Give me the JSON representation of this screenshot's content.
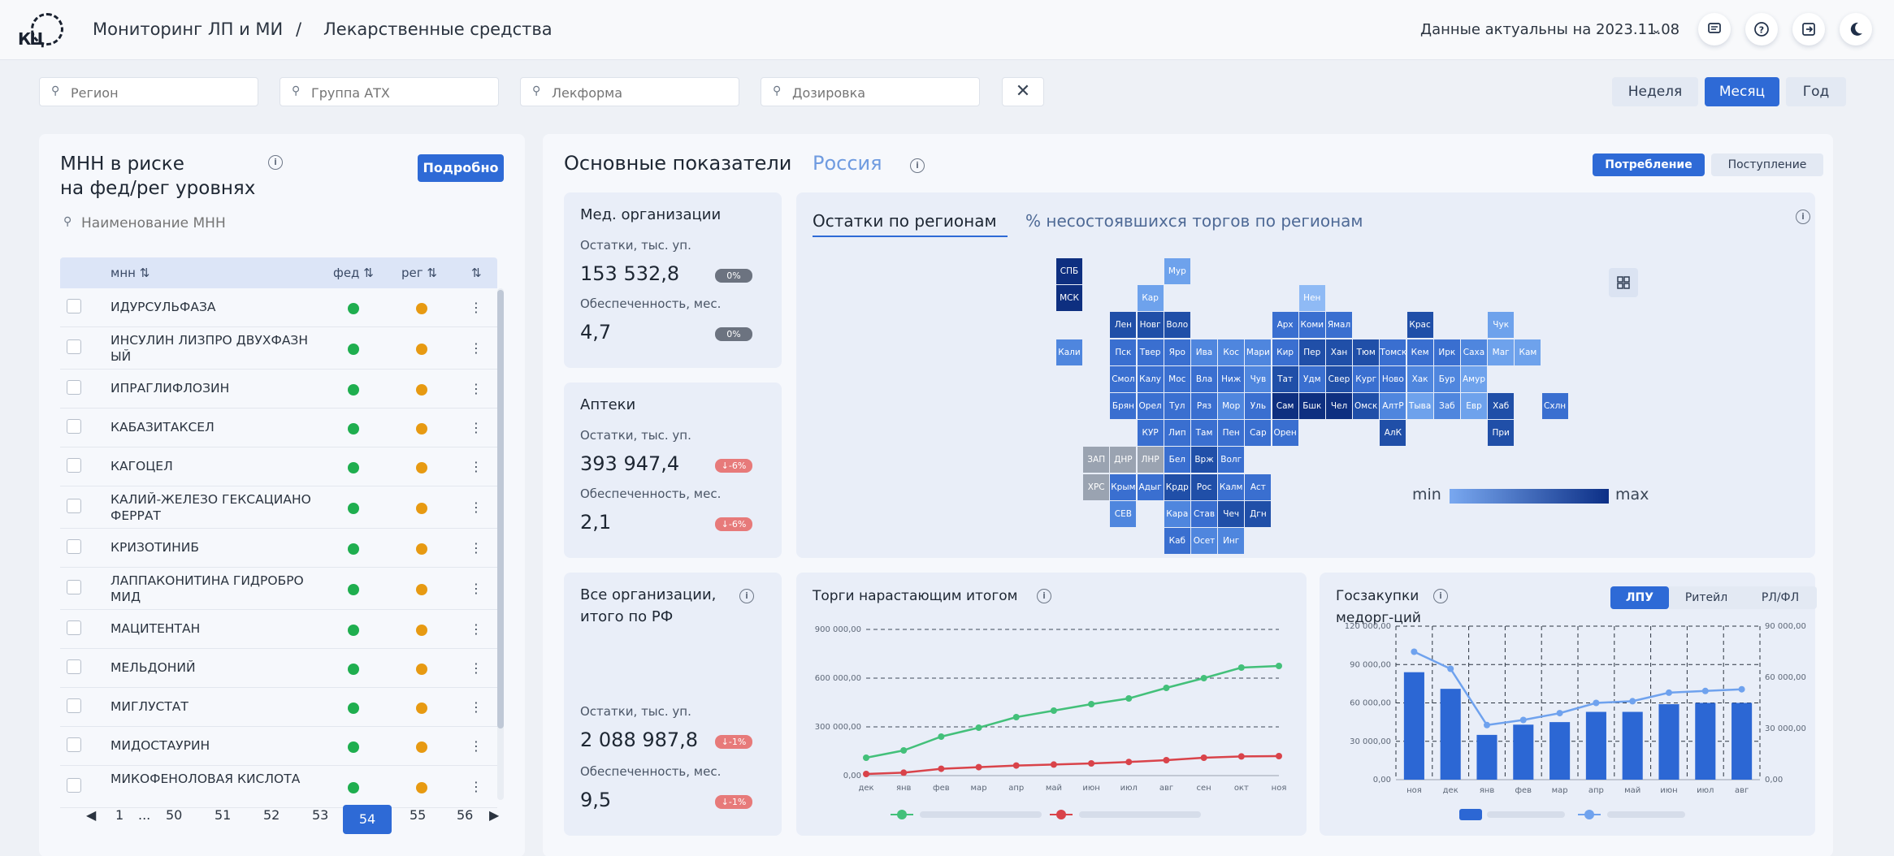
{
  "header": {
    "logo_text": "КЦ",
    "crumb_main": "Мониторинг ЛП и МИ",
    "crumb_sep": "/",
    "crumb_sub": "Лекарственные средства",
    "data_actual": "Данные актуальны на 2023.11.08",
    "icons": [
      "message-icon",
      "help-icon",
      "logout-icon",
      "theme-moon-icon"
    ]
  },
  "filters": {
    "region": "Регион",
    "atc": "Группа АТХ",
    "form": "Лекформа",
    "dose": "Дозировка",
    "clear_glyph": "✕"
  },
  "period": {
    "week": "Неделя",
    "month": "Месяц",
    "year": "Год",
    "selected": "Месяц"
  },
  "left": {
    "title": "МНН в риске\nна фед/рег уровнях",
    "detail_btn": "Подробно",
    "search_placeholder": "Наименование МНН",
    "cols": {
      "name": "мнн ⇅",
      "fed": "фед ⇅",
      "reg": "рег ⇅",
      "last": "⇅"
    },
    "rows": [
      {
        "name": "ИДУРСУЛЬФАЗА",
        "fed": "green",
        "reg": "orange"
      },
      {
        "name": "ИНСУЛИН ЛИЗПРО ДВУХФАЗН ЫЙ",
        "fed": "green",
        "reg": "orange"
      },
      {
        "name": "ИПРАГЛИФЛОЗИН",
        "fed": "green",
        "reg": "orange"
      },
      {
        "name": "КАБАЗИТАКСЕЛ",
        "fed": "green",
        "reg": "orange"
      },
      {
        "name": "КАГОЦЕЛ",
        "fed": "green",
        "reg": "orange"
      },
      {
        "name": "КАЛИЙ-ЖЕЛЕЗО ГЕКСАЦИАНО ФЕРРАТ",
        "fed": "green",
        "reg": "orange"
      },
      {
        "name": "КРИЗОТИНИБ",
        "fed": "green",
        "reg": "orange"
      },
      {
        "name": "ЛАППАКОНИТИНА ГИДРОБРО МИД",
        "fed": "green",
        "reg": "orange"
      },
      {
        "name": "МАЦИТЕНТАН",
        "fed": "green",
        "reg": "orange"
      },
      {
        "name": "МЕЛЬДОНИЙ",
        "fed": "green",
        "reg": "orange"
      },
      {
        "name": "МИГЛУСТАТ",
        "fed": "green",
        "reg": "orange"
      },
      {
        "name": "МИДОСТАУРИН",
        "fed": "green",
        "reg": "orange"
      },
      {
        "name": "МИКОФЕНОЛОВАЯ КИСЛОТА",
        "fed": "green",
        "reg": "orange"
      }
    ],
    "pager": {
      "prev": "◀",
      "first": "1",
      "dots": "...",
      "pages": [
        "50",
        "51",
        "52",
        "53"
      ],
      "current": "54",
      "after": [
        "55",
        "56"
      ],
      "next": "▶"
    }
  },
  "main": {
    "title": "Основные показатели",
    "region": "Россия",
    "toggle_cons": "Потребление",
    "toggle_rec": "Поступление",
    "cards": [
      {
        "title": "Мед. организации",
        "l1": "Остатки, тыс. уп.",
        "v1": "153 532,8",
        "b1": "0%",
        "b1c": "gray",
        "l2": "Обеспеченность, мес.",
        "v2": "4,7",
        "b2": "0%",
        "b2c": "gray"
      },
      {
        "title": "Аптеки",
        "l1": "Остатки, тыс. уп.",
        "v1": "393 947,4",
        "b1": "↓-6%",
        "b1c": "red",
        "l2": "Обеспеченность, мес.",
        "v2": "2,1",
        "b2": "↓-6%",
        "b2c": "red"
      },
      {
        "title": "Все организации,\nитого по РФ",
        "l1": "Остатки, тыс. уп.",
        "v1": "2 088 987,8",
        "b1": "↓-1%",
        "b1c": "red",
        "l2": "Обеспеченность, мес.",
        "v2": "9,5",
        "b2": "↓-1%",
        "b2c": "red"
      }
    ],
    "map": {
      "tab1": "Остатки по регионам",
      "tab2": "% несостоявшихся торгов по регионам",
      "legend_min": "min",
      "legend_max": "max",
      "cells": [
        {
          "t": "СПБ",
          "c": 0,
          "r": 0,
          "s": 5
        },
        {
          "t": "МСК",
          "c": 0,
          "r": 1,
          "s": 5
        },
        {
          "t": "Мур",
          "c": 4,
          "r": 0,
          "s": 1
        },
        {
          "t": "Кар",
          "c": 3,
          "r": 1,
          "s": 1
        },
        {
          "t": "Нен",
          "c": 9,
          "r": 1,
          "s": 0
        },
        {
          "t": "Лен",
          "c": 2,
          "r": 2,
          "s": 4
        },
        {
          "t": "Новг",
          "c": 3,
          "r": 2,
          "s": 4
        },
        {
          "t": "Воло",
          "c": 4,
          "r": 2,
          "s": 4
        },
        {
          "t": "Арх",
          "c": 8,
          "r": 2,
          "s": 3
        },
        {
          "t": "Коми",
          "c": 9,
          "r": 2,
          "s": 3
        },
        {
          "t": "Ямал",
          "c": 10,
          "r": 2,
          "s": 3
        },
        {
          "t": "Крас",
          "c": 13,
          "r": 2,
          "s": 4
        },
        {
          "t": "Чук",
          "c": 16,
          "r": 2,
          "s": 1
        },
        {
          "t": "Кали",
          "c": 0,
          "r": 3,
          "s": 2
        },
        {
          "t": "Пск",
          "c": 2,
          "r": 3,
          "s": 3
        },
        {
          "t": "Твер",
          "c": 3,
          "r": 3,
          "s": 3
        },
        {
          "t": "Яро",
          "c": 4,
          "r": 3,
          "s": 3
        },
        {
          "t": "Ива",
          "c": 5,
          "r": 3,
          "s": 2
        },
        {
          "t": "Кос",
          "c": 6,
          "r": 3,
          "s": 2
        },
        {
          "t": "Мари",
          "c": 7,
          "r": 3,
          "s": 2
        },
        {
          "t": "Кир",
          "c": 8,
          "r": 3,
          "s": 3
        },
        {
          "t": "Пер",
          "c": 9,
          "r": 3,
          "s": 4
        },
        {
          "t": "Хан",
          "c": 10,
          "r": 3,
          "s": 4
        },
        {
          "t": "Тюм",
          "c": 11,
          "r": 3,
          "s": 4
        },
        {
          "t": "Томск",
          "c": 12,
          "r": 3,
          "s": 3
        },
        {
          "t": "Кем",
          "c": 13,
          "r": 3,
          "s": 3
        },
        {
          "t": "Ирк",
          "c": 14,
          "r": 3,
          "s": 3
        },
        {
          "t": "Саха",
          "c": 15,
          "r": 3,
          "s": 2
        },
        {
          "t": "Маг",
          "c": 16,
          "r": 3,
          "s": 1
        },
        {
          "t": "Кам",
          "c": 17,
          "r": 3,
          "s": 1
        },
        {
          "t": "Смол",
          "c": 2,
          "r": 4,
          "s": 3
        },
        {
          "t": "Калу",
          "c": 3,
          "r": 4,
          "s": 3
        },
        {
          "t": "Мос",
          "c": 4,
          "r": 4,
          "s": 3
        },
        {
          "t": "Вла",
          "c": 5,
          "r": 4,
          "s": 3
        },
        {
          "t": "Ниж",
          "c": 6,
          "r": 4,
          "s": 3
        },
        {
          "t": "Чув",
          "c": 7,
          "r": 4,
          "s": 2
        },
        {
          "t": "Тат",
          "c": 8,
          "r": 4,
          "s": 4
        },
        {
          "t": "Удм",
          "c": 9,
          "r": 4,
          "s": 3
        },
        {
          "t": "Свер",
          "c": 10,
          "r": 4,
          "s": 4
        },
        {
          "t": "Кург",
          "c": 11,
          "r": 4,
          "s": 3
        },
        {
          "t": "Ново",
          "c": 12,
          "r": 4,
          "s": 3
        },
        {
          "t": "Хак",
          "c": 13,
          "r": 4,
          "s": 2
        },
        {
          "t": "Бур",
          "c": 14,
          "r": 4,
          "s": 2
        },
        {
          "t": "Амур",
          "c": 15,
          "r": 4,
          "s": 1
        },
        {
          "t": "Брян",
          "c": 2,
          "r": 5,
          "s": 3
        },
        {
          "t": "Орел",
          "c": 3,
          "r": 5,
          "s": 3
        },
        {
          "t": "Тул",
          "c": 4,
          "r": 5,
          "s": 3
        },
        {
          "t": "Ряз",
          "c": 5,
          "r": 5,
          "s": 3
        },
        {
          "t": "Мор",
          "c": 6,
          "r": 5,
          "s": 2
        },
        {
          "t": "Уль",
          "c": 7,
          "r": 5,
          "s": 3
        },
        {
          "t": "Сам",
          "c": 8,
          "r": 5,
          "s": 5
        },
        {
          "t": "Бшк",
          "c": 9,
          "r": 5,
          "s": 5
        },
        {
          "t": "Чел",
          "c": 10,
          "r": 5,
          "s": 5
        },
        {
          "t": "Омск",
          "c": 11,
          "r": 5,
          "s": 4
        },
        {
          "t": "АлтР",
          "c": 12,
          "r": 5,
          "s": 2
        },
        {
          "t": "Тыва",
          "c": 13,
          "r": 5,
          "s": 1
        },
        {
          "t": "Заб",
          "c": 14,
          "r": 5,
          "s": 2
        },
        {
          "t": "Евр",
          "c": 15,
          "r": 5,
          "s": 1
        },
        {
          "t": "Хаб",
          "c": 16,
          "r": 5,
          "s": 4
        },
        {
          "t": "Схлн",
          "c": 18,
          "r": 5,
          "s": 3
        },
        {
          "t": "КУР",
          "c": 3,
          "r": 6,
          "s": 3
        },
        {
          "t": "Лип",
          "c": 4,
          "r": 6,
          "s": 3
        },
        {
          "t": "Там",
          "c": 5,
          "r": 6,
          "s": 3
        },
        {
          "t": "Пен",
          "c": 6,
          "r": 6,
          "s": 3
        },
        {
          "t": "Сар",
          "c": 7,
          "r": 6,
          "s": 3
        },
        {
          "t": "Орен",
          "c": 8,
          "r": 6,
          "s": 3
        },
        {
          "t": "АлК",
          "c": 12,
          "r": 6,
          "s": 4
        },
        {
          "t": "При",
          "c": 16,
          "r": 6,
          "s": 4
        },
        {
          "t": "ЗАП",
          "c": 1,
          "r": 7,
          "s": 9
        },
        {
          "t": "ДНР",
          "c": 2,
          "r": 7,
          "s": 9
        },
        {
          "t": "ЛНР",
          "c": 3,
          "r": 7,
          "s": 9
        },
        {
          "t": "Бел",
          "c": 4,
          "r": 7,
          "s": 3
        },
        {
          "t": "Врж",
          "c": 5,
          "r": 7,
          "s": 4
        },
        {
          "t": "Волг",
          "c": 6,
          "r": 7,
          "s": 3
        },
        {
          "t": "ХРС",
          "c": 1,
          "r": 8,
          "s": 9
        },
        {
          "t": "Крым",
          "c": 2,
          "r": 8,
          "s": 3
        },
        {
          "t": "Адыг",
          "c": 3,
          "r": 8,
          "s": 3
        },
        {
          "t": "Крдр",
          "c": 4,
          "r": 8,
          "s": 4
        },
        {
          "t": "Рос",
          "c": 5,
          "r": 8,
          "s": 4
        },
        {
          "t": "Калм",
          "c": 6,
          "r": 8,
          "s": 3
        },
        {
          "t": "Аст",
          "c": 7,
          "r": 8,
          "s": 3
        },
        {
          "t": "СЕВ",
          "c": 2,
          "r": 9,
          "s": 2
        },
        {
          "t": "Кара",
          "c": 4,
          "r": 9,
          "s": 2
        },
        {
          "t": "Став",
          "c": 5,
          "r": 9,
          "s": 3
        },
        {
          "t": "Чеч",
          "c": 6,
          "r": 9,
          "s": 4
        },
        {
          "t": "Дгн",
          "c": 7,
          "r": 9,
          "s": 4
        },
        {
          "t": "Каб",
          "c": 4,
          "r": 10,
          "s": 3
        },
        {
          "t": "Осет",
          "c": 5,
          "r": 10,
          "s": 2
        },
        {
          "t": "Инг",
          "c": 6,
          "r": 10,
          "s": 2
        }
      ],
      "colors": [
        "#8fbaf5",
        "#6ea2ec",
        "#4f86de",
        "#3a6fd0",
        "#204fa8",
        "#0e2f80",
        "#0e2f80",
        "#0e2f80",
        "#0e2f80",
        "#9aa3b1"
      ]
    },
    "trades": {
      "title": "Торги нарастающим итогом"
    },
    "gos": {
      "title": "Госзакупки\nмедорг-ций",
      "seg": [
        "ЛПУ",
        "Ритейл",
        "РЛ/ФЛ"
      ]
    }
  },
  "chart_data": [
    {
      "type": "line",
      "title": "Торги нарастающим итогом",
      "x": [
        "дек",
        "янв",
        "фев",
        "мар",
        "апр",
        "май",
        "июн",
        "июл",
        "авг",
        "сен",
        "окт",
        "ноя"
      ],
      "ylim": [
        0,
        900000
      ],
      "yticks": [
        "0,00",
        "300 000,00",
        "600 000,00",
        "900 000,00"
      ],
      "grid": true,
      "series": [
        {
          "values": [
            110000,
            155000,
            240000,
            295000,
            360000,
            400000,
            440000,
            475000,
            540000,
            600000,
            665000,
            675000
          ],
          "color": "#43c07a"
        },
        {
          "values": [
            10000,
            18000,
            42000,
            52000,
            62000,
            68000,
            75000,
            84000,
            95000,
            110000,
            118000,
            120000
          ],
          "color": "#d9434a"
        }
      ]
    },
    {
      "type": "bar",
      "title": "Госзакупки медорг-ций",
      "categories": [
        "ноя",
        "дек",
        "янв",
        "фев",
        "мар",
        "апр",
        "май",
        "июн",
        "июл",
        "авг"
      ],
      "ylim": [
        0,
        120000
      ],
      "yticks": [
        "0,00",
        "30 000,00",
        "60 000,00",
        "90 000,00",
        "120 000,00"
      ],
      "y2lim": [
        0,
        90000
      ],
      "y2ticks": [
        "0,00",
        "30 000,00",
        "60 000,00",
        "90 000,00"
      ],
      "series": [
        {
          "type": "bar",
          "values": [
            84000,
            71000,
            35000,
            43000,
            45000,
            53000,
            53000,
            59000,
            60000,
            60000
          ],
          "color": "#2c67d4"
        },
        {
          "type": "line",
          "axis": "right",
          "values": [
            75000,
            65000,
            32000,
            35000,
            39000,
            45000,
            46000,
            51000,
            52000,
            53000
          ],
          "color": "#6fa2ee"
        }
      ]
    }
  ]
}
